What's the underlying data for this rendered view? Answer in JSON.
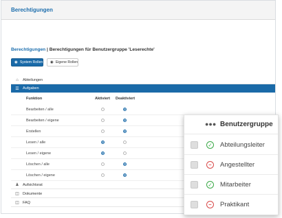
{
  "header": {
    "title": "Berechtigungen"
  },
  "breadcrumb": {
    "link": "Berechtigungen",
    "separator": "|",
    "current": "Berechtigungen für Benutzergruppe 'Leserechte'"
  },
  "buttons": {
    "system_roles": "System Rollen",
    "own_roles": "Eigene Rollen"
  },
  "sections": {
    "abteilungen": "Abteilungen",
    "aufgaben": "Aufgaben",
    "aufsichtsrat": "Aufsichtsrat",
    "dokumente": "Dokumente",
    "faq": "FAQ"
  },
  "table": {
    "columns": {
      "funktion": "Funktion",
      "aktiviert": "Aktiviert",
      "deaktiviert": "Deaktiviert"
    },
    "rows": [
      {
        "label": "Bearbeiten / alle",
        "state": "deaktiviert"
      },
      {
        "label": "Bearbeiten / eigene",
        "state": "deaktiviert"
      },
      {
        "label": "Erstellen",
        "state": "deaktiviert"
      },
      {
        "label": "Lesen / alle",
        "state": "aktiviert"
      },
      {
        "label": "Lesen / eigene",
        "state": "aktiviert"
      },
      {
        "label": "Löschen / alle",
        "state": "deaktiviert"
      },
      {
        "label": "Löschen / eigene",
        "state": "deaktiviert"
      }
    ]
  },
  "overlay": {
    "title": "Benutzergruppe",
    "groups": [
      {
        "name": "Abteilungsleiter",
        "status": "allowed"
      },
      {
        "name": "Angestellter",
        "status": "denied"
      },
      {
        "name": "Mitarbeiter",
        "status": "allowed"
      },
      {
        "name": "Praktikant",
        "status": "denied"
      }
    ]
  },
  "colors": {
    "primary": "#1a6aa8",
    "allowed": "#38a845",
    "denied": "#d84848"
  }
}
